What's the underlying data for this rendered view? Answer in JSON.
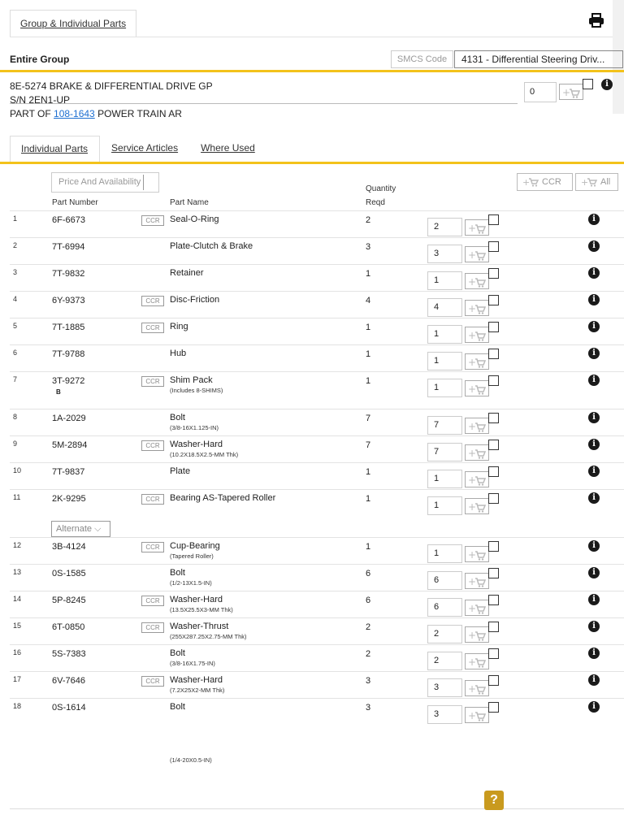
{
  "top_tab": "Group & Individual Parts",
  "entire_group": "Entire Group",
  "smcs_label": "SMCS Code",
  "smcs_value": "4131 - Differential Steering Driv...",
  "group": {
    "line1": "8E-5274 BRAKE & DIFFERENTIAL DRIVE GP",
    "line2": "S/N 2EN1-UP",
    "part_of_prefix": "PART OF ",
    "part_of_link": "108-1643",
    "part_of_suffix": " POWER TRAIN AR",
    "qty": "0"
  },
  "tabs": [
    "Individual Parts",
    "Service Articles",
    "Where Used"
  ],
  "price_availability": "Price And Availability",
  "headers": {
    "part_number": "Part Number",
    "part_name": "Part Name",
    "quantity": "Quantity",
    "reqd": "Reqd",
    "ccr_cart": "CCR",
    "all_cart": "All"
  },
  "ccr_label": "CCR",
  "alternate_label": "Alternate",
  "rows": [
    {
      "num": "1",
      "pn": "6F-6673",
      "ccr": true,
      "name": "Seal-O-Ring",
      "desc": "",
      "note": "",
      "reqd": "2",
      "qty": "2"
    },
    {
      "num": "2",
      "pn": "7T-6994",
      "ccr": false,
      "name": "Plate-Clutch & Brake",
      "desc": "",
      "note": "",
      "reqd": "3",
      "qty": "3"
    },
    {
      "num": "3",
      "pn": "7T-9832",
      "ccr": false,
      "name": "Retainer",
      "desc": "",
      "note": "",
      "reqd": "1",
      "qty": "1"
    },
    {
      "num": "4",
      "pn": "6Y-9373",
      "ccr": true,
      "name": "Disc-Friction",
      "desc": "",
      "note": "",
      "reqd": "4",
      "qty": "4"
    },
    {
      "num": "5",
      "pn": "7T-1885",
      "ccr": true,
      "name": "Ring",
      "desc": "",
      "note": "",
      "reqd": "1",
      "qty": "1"
    },
    {
      "num": "6",
      "pn": "7T-9788",
      "ccr": false,
      "name": "Hub",
      "desc": "",
      "note": "",
      "reqd": "1",
      "qty": "1"
    },
    {
      "num": "7",
      "pn": "3T-9272",
      "ccr": true,
      "name": "Shim Pack",
      "desc": "(Includes 8-SHIMS)",
      "note": "B",
      "reqd": "1",
      "qty": "1"
    },
    {
      "num": "8",
      "pn": "1A-2029",
      "ccr": false,
      "name": "Bolt",
      "desc": "(3/8-16X1.125-IN)",
      "note": "",
      "reqd": "7",
      "qty": "7"
    },
    {
      "num": "9",
      "pn": "5M-2894",
      "ccr": true,
      "name": "Washer-Hard",
      "desc": "(10.2X18.5X2.5-MM Thk)",
      "note": "",
      "reqd": "7",
      "qty": "7"
    },
    {
      "num": "10",
      "pn": "7T-9837",
      "ccr": false,
      "name": "Plate",
      "desc": "",
      "note": "",
      "reqd": "1",
      "qty": "1"
    },
    {
      "num": "11",
      "pn": "2K-9295",
      "ccr": true,
      "name": "Bearing AS-Tapered Roller",
      "desc": "",
      "note": "",
      "reqd": "1",
      "qty": "1"
    },
    {
      "num": "12",
      "pn": "3B-4124",
      "ccr": true,
      "name": "Cup-Bearing",
      "desc": "(Tapered Roller)",
      "note": "",
      "reqd": "1",
      "qty": "1"
    },
    {
      "num": "13",
      "pn": "0S-1585",
      "ccr": false,
      "name": "Bolt",
      "desc": "(1/2-13X1.5-IN)",
      "note": "",
      "reqd": "6",
      "qty": "6"
    },
    {
      "num": "14",
      "pn": "5P-8245",
      "ccr": true,
      "name": "Washer-Hard",
      "desc": "(13.5X25.5X3-MM Thk)",
      "note": "",
      "reqd": "6",
      "qty": "6"
    },
    {
      "num": "15",
      "pn": "6T-0850",
      "ccr": true,
      "name": "Washer-Thrust",
      "desc": "(255X287.25X2.75-MM Thk)",
      "note": "",
      "reqd": "2",
      "qty": "2"
    },
    {
      "num": "16",
      "pn": "5S-7383",
      "ccr": false,
      "name": "Bolt",
      "desc": "(3/8-16X1.75-IN)",
      "note": "",
      "reqd": "2",
      "qty": "2"
    },
    {
      "num": "17",
      "pn": "6V-7646",
      "ccr": true,
      "name": "Washer-Hard",
      "desc": "(7.2X25X2-MM Thk)",
      "note": "",
      "reqd": "3",
      "qty": "3"
    },
    {
      "num": "18",
      "pn": "0S-1614",
      "ccr": false,
      "name": "Bolt",
      "desc": "",
      "note": "",
      "reqd": "3",
      "qty": "3"
    }
  ],
  "trailing_desc": "(1/4-20X0.5-IN)",
  "help_label": "?",
  "colors": {
    "accent": "#f3c21b",
    "link": "#1d6fd1",
    "help": "#c99a1e"
  }
}
